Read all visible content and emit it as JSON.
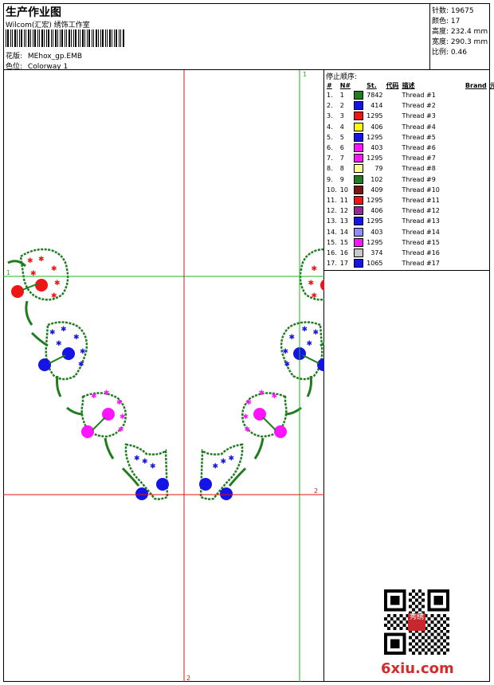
{
  "header": {
    "title": "生产作业图",
    "company": "Wilcom(汇宏) 绣饰工作室",
    "pattern_label": "花版:",
    "pattern_value": "MEhox_gp.EMB",
    "colorway_label": "色位:",
    "colorway_value": "Colorway 1"
  },
  "stats": [
    {
      "label": "针数:",
      "value": "19675"
    },
    {
      "label": "颜色:",
      "value": "17"
    },
    {
      "label": "高度:",
      "value": "232.4 mm"
    },
    {
      "label": "宽度:",
      "value": "290.3 mm"
    },
    {
      "label": "比例:",
      "value": "0.46"
    }
  ],
  "threads": {
    "title": "停止顺序:",
    "headers": [
      "#",
      "N#",
      "",
      "St.",
      "代码",
      "描述",
      "Brand",
      "元素"
    ],
    "rows": [
      {
        "n": "1.",
        "id": "1",
        "color": "#1f7d1f",
        "st": "7842",
        "desc": "Thread #1"
      },
      {
        "n": "2.",
        "id": "2",
        "color": "#1414e6",
        "st": "414",
        "desc": "Thread #2"
      },
      {
        "n": "3.",
        "id": "3",
        "color": "#f01414",
        "st": "1295",
        "desc": "Thread #3"
      },
      {
        "n": "4.",
        "id": "4",
        "color": "#ffff00",
        "st": "406",
        "desc": "Thread #4"
      },
      {
        "n": "5.",
        "id": "5",
        "color": "#1414e6",
        "st": "1295",
        "desc": "Thread #5"
      },
      {
        "n": "6.",
        "id": "6",
        "color": "#ff14ff",
        "st": "403",
        "desc": "Thread #6"
      },
      {
        "n": "7.",
        "id": "7",
        "color": "#ff14ff",
        "st": "1295",
        "desc": "Thread #7"
      },
      {
        "n": "8.",
        "id": "8",
        "color": "#ffff8c",
        "st": "79",
        "desc": "Thread #8"
      },
      {
        "n": "9.",
        "id": "9",
        "color": "#1f7d1f",
        "st": "102",
        "desc": "Thread #9"
      },
      {
        "n": "10.",
        "id": "10",
        "color": "#7d1414",
        "st": "409",
        "desc": "Thread #10"
      },
      {
        "n": "11.",
        "id": "11",
        "color": "#f01414",
        "st": "1295",
        "desc": "Thread #11"
      },
      {
        "n": "12.",
        "id": "12",
        "color": "#962896",
        "st": "406",
        "desc": "Thread #12"
      },
      {
        "n": "13.",
        "id": "13",
        "color": "#1414e6",
        "st": "1295",
        "desc": "Thread #13"
      },
      {
        "n": "14.",
        "id": "14",
        "color": "#8c8cff",
        "st": "403",
        "desc": "Thread #14"
      },
      {
        "n": "15.",
        "id": "15",
        "color": "#ff14ff",
        "st": "1295",
        "desc": "Thread #15"
      },
      {
        "n": "16.",
        "id": "16",
        "color": "#c8c8c8",
        "st": "374",
        "desc": "Thread #16"
      },
      {
        "n": "17.",
        "id": "17",
        "color": "#1414e6",
        "st": "1065",
        "desc": "Thread #17"
      }
    ]
  },
  "guides": {
    "green_h": "1",
    "green_v": "1",
    "red_h": "2",
    "red_v": "2"
  },
  "watermark": "6xiu.com",
  "stamp": "秀绣"
}
